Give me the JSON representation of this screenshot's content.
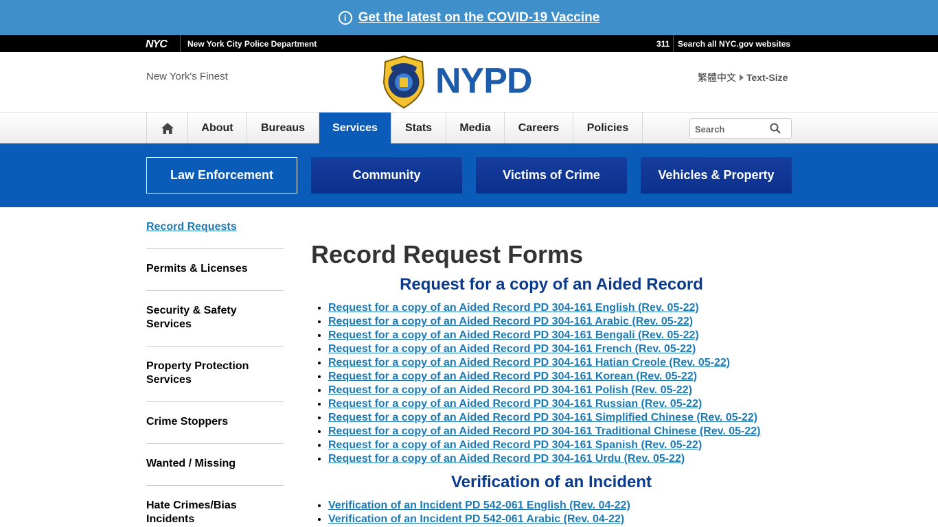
{
  "covid_banner": {
    "info_icon": "info-icon",
    "link": "Get the latest on the COVID-19 Vaccine"
  },
  "nyc_bar": {
    "logo": "NYC",
    "department": "New York City Police Department",
    "n311": "311",
    "search_all": "Search all NYC.gov websites"
  },
  "header": {
    "tagline": "New York's Finest",
    "brand": "NYPD",
    "badge_icon": "police-badge-icon",
    "translate": "繁體中文",
    "text_size": "Text-Size"
  },
  "main_nav": {
    "home_icon": "home-icon",
    "items": [
      "About",
      "Bureaus",
      "Services",
      "Stats",
      "Media",
      "Careers",
      "Policies"
    ],
    "active": "Services",
    "search_placeholder": "Search",
    "search_icon": "magnifier-icon"
  },
  "sub_nav": {
    "items": [
      "Law Enforcement",
      "Community",
      "Victims of Crime",
      "Vehicles & Property"
    ],
    "active": "Law Enforcement"
  },
  "sidebar": {
    "current": "Record Requests",
    "items": [
      "Permits & Licenses",
      "Security & Safety Services",
      "Property Protection Services",
      "Crime Stoppers",
      "Wanted / Missing",
      "Hate Crimes/Bias Incidents"
    ]
  },
  "content": {
    "title": "Record Request Forms",
    "sections": [
      {
        "heading": "Request for a copy of an Aided Record",
        "links": [
          "Request for a copy of an Aided Record PD 304-161 English (Rev. 05-22)",
          "Request for a copy of an Aided Record PD 304-161 Arabic (Rev. 05-22)",
          "Request for a copy of an Aided Record PD 304-161 Bengali (Rev. 05-22)",
          "Request for a copy of an Aided Record PD 304-161 French (Rev. 05-22)",
          "Request for a copy of an Aided Record PD 304-161 Hatian Creole (Rev. 05-22)",
          "Request for a copy of an Aided Record PD 304-161 Korean (Rev. 05-22)",
          "Request for a copy of an Aided Record PD 304-161 Polish (Rev. 05-22)",
          "Request for a copy of an Aided Record PD 304-161 Russian (Rev. 05-22)",
          "Request for a copy of an Aided Record PD 304-161 Simplified Chinese (Rev. 05-22)",
          "Request for a copy of an Aided Record PD 304-161 Traditional Chinese (Rev. 05-22)",
          "Request for a copy of an Aided Record PD 304-161 Spanish (Rev. 05-22)",
          "Request for a copy of an Aided Record PD 304-161 Urdu (Rev. 05-22)"
        ]
      },
      {
        "heading": "Verification of an Incident",
        "links": [
          "Verification of an Incident PD 542-061 English (Rev. 04-22)",
          "Verification of an Incident PD 542-061 Arabic (Rev. 04-22)"
        ]
      }
    ]
  },
  "colors": {
    "banner": "#3f8fcb",
    "brand_blue": "#1c5cab",
    "nav_active": "#0a5cb8",
    "subnav_button": "#0b2f8c",
    "link": "#1c7ab5",
    "heading": "#0a3a8c"
  }
}
